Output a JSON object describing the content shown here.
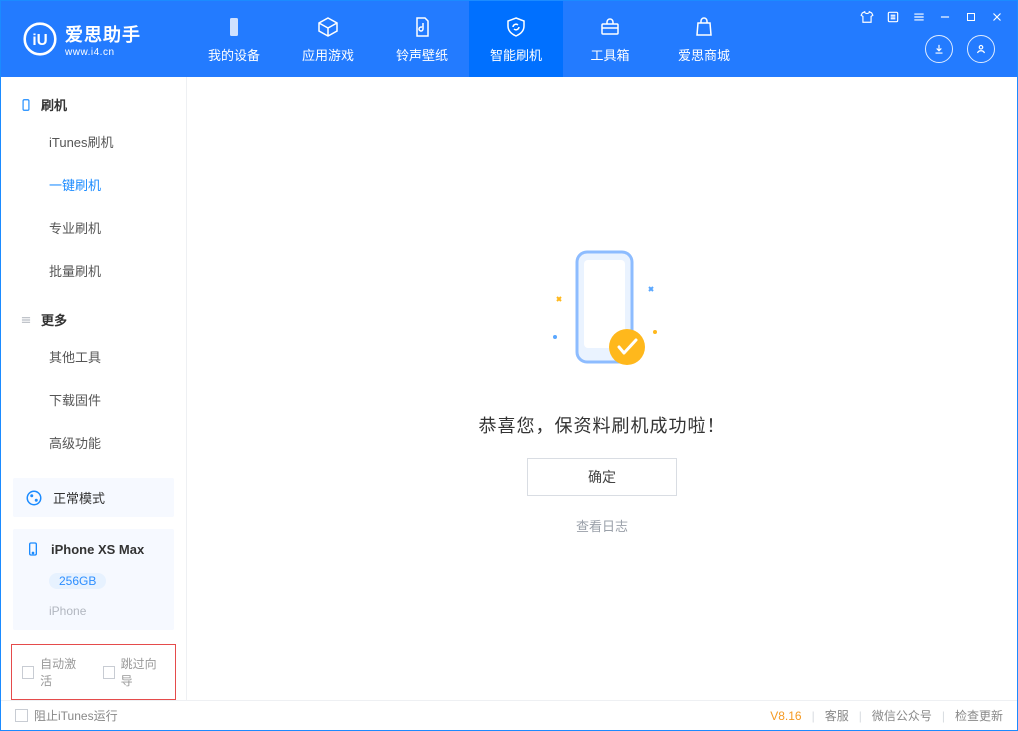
{
  "app": {
    "name_cn": "爱思助手",
    "url": "www.i4.cn"
  },
  "titlebar_icons": [
    "shirt-icon",
    "list-icon",
    "settings-icon",
    "minimize-icon",
    "maximize-icon",
    "close-icon"
  ],
  "nav": [
    {
      "key": "device",
      "label": "我的设备"
    },
    {
      "key": "apps",
      "label": "应用游戏"
    },
    {
      "key": "media",
      "label": "铃声壁纸"
    },
    {
      "key": "flash",
      "label": "智能刷机",
      "active": true
    },
    {
      "key": "tools",
      "label": "工具箱"
    },
    {
      "key": "store",
      "label": "爱思商城"
    }
  ],
  "sidebar": {
    "group1": {
      "title": "刷机",
      "items": [
        {
          "key": "itunes",
          "label": "iTunes刷机"
        },
        {
          "key": "oneclick",
          "label": "一键刷机",
          "active": true
        },
        {
          "key": "pro",
          "label": "专业刷机"
        },
        {
          "key": "batch",
          "label": "批量刷机"
        }
      ]
    },
    "group2": {
      "title": "更多",
      "items": [
        {
          "key": "other",
          "label": "其他工具"
        },
        {
          "key": "firmware",
          "label": "下载固件"
        },
        {
          "key": "advanced",
          "label": "高级功能"
        }
      ]
    }
  },
  "status": {
    "label": "正常模式"
  },
  "device": {
    "name": "iPhone XS Max",
    "capacity": "256GB",
    "type": "iPhone"
  },
  "checks": {
    "auto_activate": "自动激活",
    "skip_guide": "跳过向导"
  },
  "result": {
    "message": "恭喜您，保资料刷机成功啦！",
    "ok": "确定",
    "view_log": "查看日志"
  },
  "footer": {
    "stop_itunes": "阻止iTunes运行",
    "version": "V8.16",
    "cs": "客服",
    "wechat": "微信公众号",
    "update": "检查更新"
  }
}
